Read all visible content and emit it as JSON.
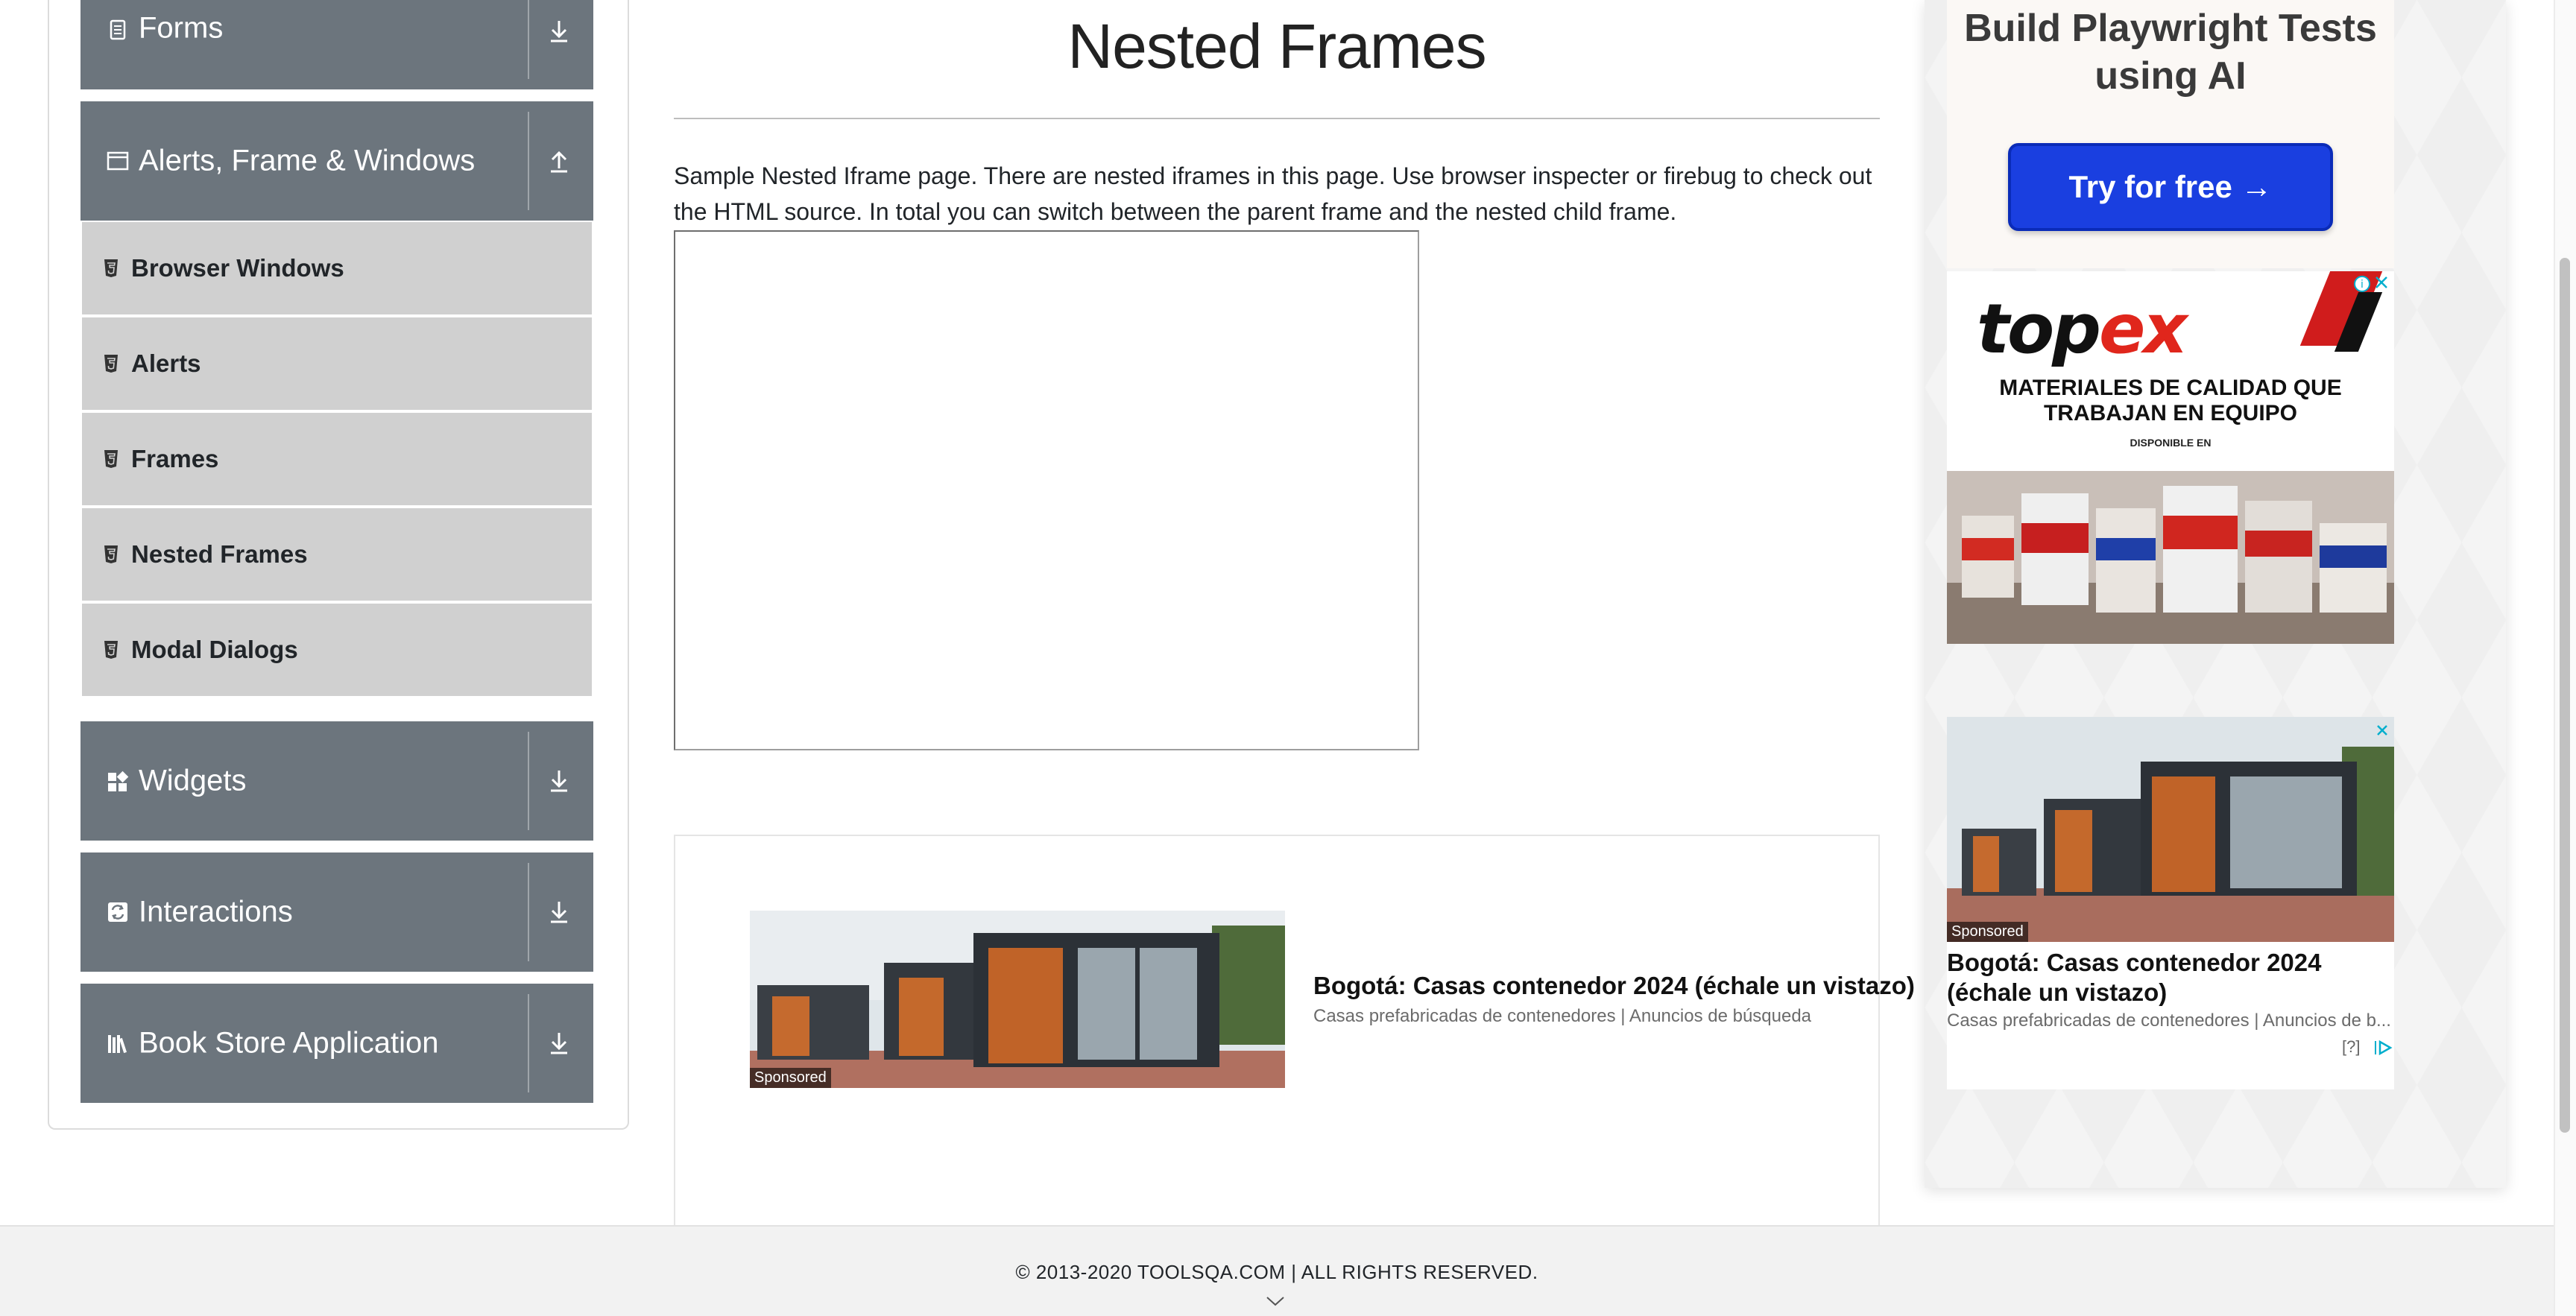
{
  "sidebar": {
    "groups": [
      {
        "label": "Forms",
        "icon": "form-icon",
        "toggle": "download-icon"
      },
      {
        "label": "Alerts, Frame & Windows",
        "icon": "window-icon",
        "toggle": "upload-icon"
      },
      {
        "label": "Widgets",
        "icon": "widgets-icon",
        "toggle": "download-icon"
      },
      {
        "label": "Interactions",
        "icon": "interactions-icon",
        "toggle": "download-icon"
      },
      {
        "label": "Book Store Application",
        "icon": "books-icon",
        "toggle": "download-icon"
      }
    ],
    "sub_items": [
      {
        "label": "Browser Windows"
      },
      {
        "label": "Alerts"
      },
      {
        "label": "Frames"
      },
      {
        "label": "Nested Frames"
      },
      {
        "label": "Modal Dialogs"
      }
    ]
  },
  "main": {
    "title": "Nested Frames",
    "description": "Sample Nested Iframe page. There are nested iframes in this page. Use browser inspecter or firebug to check out the HTML source. In total you can switch between the parent frame and the nested child frame."
  },
  "ads": {
    "inline": {
      "sponsored": "Sponsored",
      "headline": "Bogotá: Casas contenedor 2024 (échale un vistazo)",
      "sub": "Casas prefabricadas de contenedores | Anuncios de búsqueda"
    },
    "playwright": {
      "heading": "Build Playwright Tests using AI",
      "button": "Try for free →"
    },
    "topex": {
      "logo_a": "top",
      "logo_b": "ex",
      "tagline": "MATERIALES DE CALIDAD QUE TRABAJAN EN EQUIPO",
      "available": "DISPONIBLE EN",
      "accent_color": "#e0261c"
    },
    "native": {
      "sponsored": "Sponsored",
      "headline": "Bogotá: Casas contenedor 2024 (échale un vistazo)",
      "sub": "Casas prefabricadas de contenedores | Anuncios de b...",
      "help": "[?]"
    }
  },
  "footer": {
    "copyright": "© 2013-2020 TOOLSQA.COM | ALL RIGHTS RESERVED."
  },
  "colors": {
    "group_header_bg": "#6c757d",
    "sub_item_bg": "#d0d0d0",
    "cta_blue": "#1a3fe0"
  }
}
